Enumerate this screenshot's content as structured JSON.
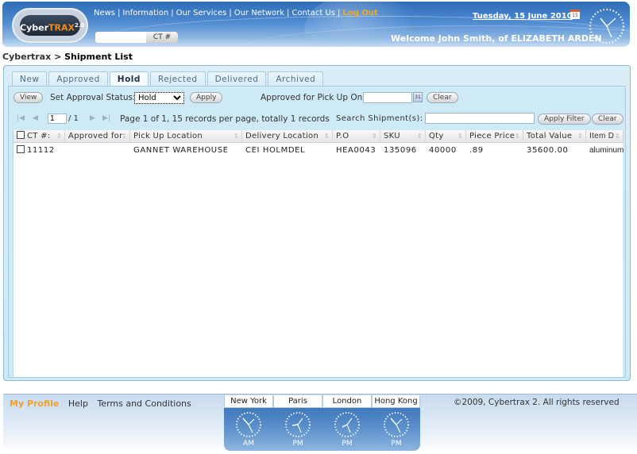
{
  "header": {
    "logo": {
      "prefix": "Cyber",
      "highlight": "TRAX",
      "version": "2.0"
    },
    "nav": [
      {
        "label": "News"
      },
      {
        "label": "Information"
      },
      {
        "label": "Our Services"
      },
      {
        "label": "Our Network"
      },
      {
        "label": "Contact Us"
      }
    ],
    "logout_label": "Log Out",
    "ct_search": {
      "value": "",
      "button_label": "CT #"
    },
    "date": "Tuesday, 15 June 2010",
    "calendar_icon_text": "15",
    "welcome": "Welcome John Smith, of ELIZABETH ARDEN"
  },
  "breadcrumb": {
    "root": "Cybertrax",
    "separator": ">",
    "current": "Shipment List"
  },
  "tabs": [
    {
      "label": "New",
      "active": false
    },
    {
      "label": "Approved",
      "active": false
    },
    {
      "label": "Hold",
      "active": true
    },
    {
      "label": "Rejected",
      "active": false
    },
    {
      "label": "Delivered",
      "active": false
    },
    {
      "label": "Archived",
      "active": false
    }
  ],
  "toolbar": {
    "view_label": "View",
    "approval_status_label": "Set Approval Status:",
    "approval_status_value": "Hold",
    "apply_label": "Apply",
    "pickup_label": "Approved for Pick Up On :",
    "pickup_value": "",
    "calendar_icon_text": "31",
    "clear_label": "Clear"
  },
  "pager": {
    "current_page": "1",
    "total_pages_text": "/ 1",
    "summary": "Page 1 of 1, 15 records per page, totally 1 records",
    "search_label": "Search Shipment(s):",
    "search_value": "",
    "apply_filter_label": "Apply Filter",
    "clear_label": "Clear"
  },
  "grid": {
    "columns": [
      "CT #:",
      "Approved for",
      "Pick Up Location",
      "Delivery Location",
      "P.O",
      "SKU",
      "Qty",
      "Piece Price",
      "Total Value",
      "Item D"
    ],
    "rows": [
      {
        "ct": "11112",
        "approved_for": "",
        "pickup": "GANNET WAREHOUSE",
        "delivery": "CEI HOLMDEL",
        "po": "HEA0043",
        "sku": "135096",
        "qty": "40000",
        "piece_price": ".89",
        "total_value": "35600.00",
        "item_desc": "aluminum"
      }
    ]
  },
  "footer": {
    "my_profile": "My Profile",
    "help": "Help",
    "terms": "Terms and Conditions",
    "copyright": "©2009, Cybertrax 2. All rights reserved",
    "clocks": [
      {
        "city": "New York",
        "ampm": "AM"
      },
      {
        "city": "Paris",
        "ampm": "PM"
      },
      {
        "city": "London",
        "ampm": "PM"
      },
      {
        "city": "Hong Kong",
        "ampm": "PM"
      }
    ]
  }
}
